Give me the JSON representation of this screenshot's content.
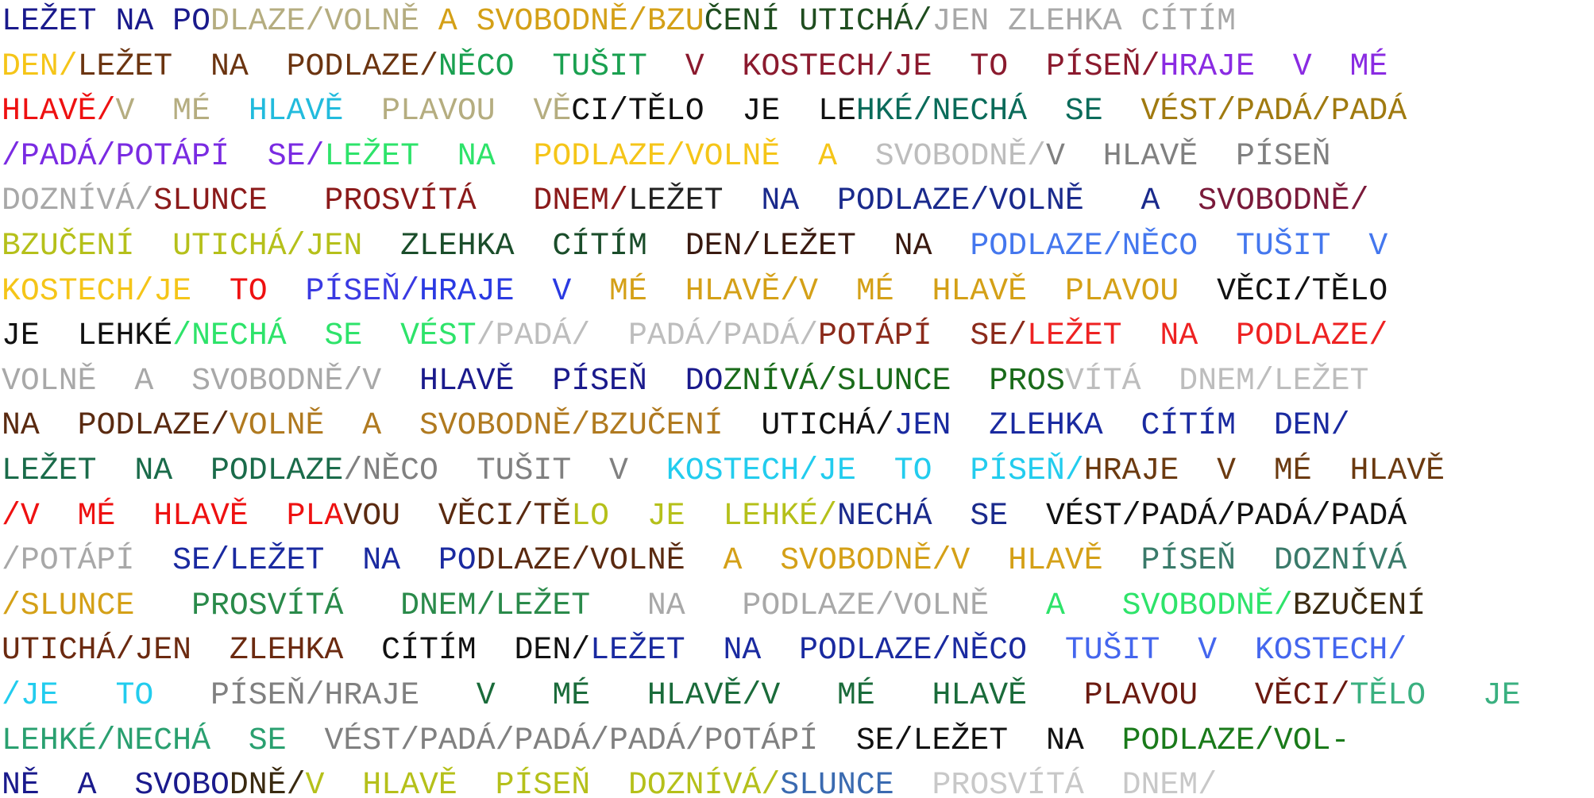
{
  "poem": {
    "lines": [
      [
        {
          "text": "LEŽET NA PO",
          "color": "#1a1a8c"
        },
        {
          "text": "DLAZE/VOLNĚ",
          "color": "#b5ad80"
        },
        {
          "text": " A SVOBODNĚ/BZU",
          "color": "#d4a017"
        },
        {
          "text": "ČENÍ UTICHÁ/",
          "color": "#1f4d1f"
        },
        {
          "text": "JEN ZLEHKA CÍTÍM",
          "color": "#a8a8a8"
        }
      ],
      [
        {
          "text": "DEN/",
          "color": "#f5c518"
        },
        {
          "text": "LEŽET  NA  PODLAZE/",
          "color": "#6b3410"
        },
        {
          "text": "NĚCO  TUŠIT",
          "color": "#1aa050"
        },
        {
          "text": "  V  KOSTECH/JE  TO  PÍSEŇ/",
          "color": "#8b1a2e"
        },
        {
          "text": "HRAJE  V  MÉ",
          "color": "#8a2be2"
        }
      ],
      [
        {
          "text": "HLAVĚ/",
          "color": "#ee1111"
        },
        {
          "text": "V  MÉ  ",
          "color": "#b5ad80"
        },
        {
          "text": "HLAVĚ",
          "color": "#22bbdd"
        },
        {
          "text": "  PLAVOU  VĚ",
          "color": "#b5ad80"
        },
        {
          "text": "CI/TĚLO  JE  LE",
          "color": "#111111"
        },
        {
          "text": "HKÉ/NECHÁ  SE",
          "color": "#0a6b5a"
        },
        {
          "text": "  VÉST/PADÁ/PADÁ",
          "color": "#a07a10"
        }
      ],
      [
        {
          "text": "/PADÁ/POTÁPÍ  SE/",
          "color": "#7a2be2"
        },
        {
          "text": "LEŽET  NA",
          "color": "#2ee36a"
        },
        {
          "text": "  PODLAZE/VOLNĚ  A",
          "color": "#f5c518"
        },
        {
          "text": "  SVOBODNĚ/",
          "color": "#bdbdbd"
        },
        {
          "text": "V  HLAVĚ  PÍSEŇ",
          "color": "#808080"
        }
      ],
      [
        {
          "text": "DOZNÍVÁ/",
          "color": "#a8a8a8"
        },
        {
          "text": "SLUNCE   PROSVÍTÁ   DNEM/",
          "color": "#8b1a1a"
        },
        {
          "text": "LEŽET  ",
          "color": "#222222"
        },
        {
          "text": "NA  PODLAZE/VOLNĚ   A",
          "color": "#1a2a8c"
        },
        {
          "text": "  SVOBODNĚ/",
          "color": "#7a1a3a"
        }
      ],
      [
        {
          "text": "BZUČENÍ  UTICHÁ/JEN",
          "color": "#b5c01a"
        },
        {
          "text": "  ZLEHKA  CÍTÍM",
          "color": "#1a4d2a"
        },
        {
          "text": "  DEN/LEŽET  NA",
          "color": "#3a1a10"
        },
        {
          "text": "  PODLAZE/NĚCO  TUŠIT  V",
          "color": "#4477ee"
        }
      ],
      [
        {
          "text": "KOSTECH/JE",
          "color": "#f5c518"
        },
        {
          "text": "  TO",
          "color": "#ee1111"
        },
        {
          "text": "  PÍSEŇ/",
          "color": "#3a3ae2"
        },
        {
          "text": "HRAJE  V",
          "color": "#2a3ae2"
        },
        {
          "text": "  MÉ  HLAVĚ/V  MÉ  HLAVĚ  PLAVOU",
          "color": "#d4a017"
        },
        {
          "text": "  VĚCI/TĚLO",
          "color": "#111111"
        }
      ],
      [
        {
          "text": "JE  LEHKÉ",
          "color": "#111111"
        },
        {
          "text": "/NECHÁ  SE  VÉST",
          "color": "#2ee36a"
        },
        {
          "text": "/PADÁ/  PADÁ/PADÁ/",
          "color": "#bdbdbd"
        },
        {
          "text": "POTÁPÍ  SE/",
          "color": "#8b2a1a"
        },
        {
          "text": "LEŽET  NA  PODLAZE/",
          "color": "#ee2222"
        }
      ],
      [
        {
          "text": "VOLNĚ  A  SVOBODNĚ/V",
          "color": "#a8a8a8"
        },
        {
          "text": "  HLAVĚ  PÍSEŇ  DO",
          "color": "#1a1a8c"
        },
        {
          "text": "ZNÍVÁ/SLUNCE  PROS",
          "color": "#1a6b1a"
        },
        {
          "text": "VÍTÁ  DNEM/LEŽET",
          "color": "#bdbdbd"
        }
      ],
      [
        {
          "text": "NA  PODLAZE/",
          "color": "#5a2a10"
        },
        {
          "text": "VOLNĚ  A  SVOBODNĚ/BZUČENÍ",
          "color": "#b07a20"
        },
        {
          "text": "  UTICHÁ/",
          "color": "#111111"
        },
        {
          "text": "JEN  ZLEHKA  CÍTÍM  DEN/",
          "color": "#1a2aa0"
        }
      ],
      [
        {
          "text": "LEŽET  NA  PODLAZE",
          "color": "#1a6b4a"
        },
        {
          "text": "/NĚCO  TUŠIT  V  ",
          "color": "#808080"
        },
        {
          "text": "KOSTECH/JE  TO  PÍSEŇ/",
          "color": "#22ccee"
        },
        {
          "text": "HRAJE  V  MÉ  HLAVĚ",
          "color": "#6b3a10"
        }
      ],
      [
        {
          "text": "/V  MÉ  HLAVĚ  PLA",
          "color": "#ee1111"
        },
        {
          "text": "VOU  VĚCI/TĚ",
          "color": "#5a2a10"
        },
        {
          "text": "LO  JE  LEHKÉ/",
          "color": "#b5c01a"
        },
        {
          "text": "NECHÁ  SE",
          "color": "#1a2a8c"
        },
        {
          "text": "  VÉST/PADÁ/PADÁ/PADÁ",
          "color": "#111111"
        }
      ],
      [
        {
          "text": "/POTÁPÍ",
          "color": "#a8a8a8"
        },
        {
          "text": "  SE/LEŽET  NA  PO",
          "color": "#1a2aa0"
        },
        {
          "text": "DLAZE/VOLNĚ",
          "color": "#5a2a10"
        },
        {
          "text": "  A  SVOBODNĚ/V  HLAVĚ",
          "color": "#d4a017"
        },
        {
          "text": "  PÍSEŇ  DOZNÍVÁ",
          "color": "#3a7a6a"
        }
      ],
      [
        {
          "text": "/SLUNCE",
          "color": "#d4a017"
        },
        {
          "text": "   PROSVÍTÁ   DNEM/LEŽET",
          "color": "#2a8a4a"
        },
        {
          "text": "   NA   PODLAZE/VOLNĚ",
          "color": "#a8a8a8"
        },
        {
          "text": "   A   SVOBODNĚ/",
          "color": "#2ee36a"
        },
        {
          "text": "BZUČENÍ",
          "color": "#3a2a10"
        }
      ],
      [
        {
          "text": "UTICHÁ/JEN  ZLEHKA",
          "color": "#6b2a10"
        },
        {
          "text": "  CÍTÍM  DEN/",
          "color": "#111111"
        },
        {
          "text": "LEŽET  NA  PODLAZE/NĚCO",
          "color": "#1a2aa0"
        },
        {
          "text": "  TUŠIT  V  KOSTECH/",
          "color": "#4466ee"
        }
      ],
      [
        {
          "text": "/JE   TO",
          "color": "#22ccee"
        },
        {
          "text": "   PÍSEŇ/HRAJE",
          "color": "#808080"
        },
        {
          "text": "   V   MÉ   HLAVĚ/V   MÉ   HLAVĚ",
          "color": "#1a6b3a"
        },
        {
          "text": "   PLAVOU   VĚCI/",
          "color": "#6b1a10"
        },
        {
          "text": "TĚLO   JE",
          "color": "#3ab080"
        }
      ],
      [
        {
          "text": "LEHKÉ/NECHÁ  SE",
          "color": "#2aa070"
        },
        {
          "text": "  VÉST/PADÁ/PADÁ/PADÁ/POTÁPÍ",
          "color": "#808080"
        },
        {
          "text": "  SE/LEŽET  NA",
          "color": "#111111"
        },
        {
          "text": "  PODLAZE/VOL-",
          "color": "#1a7a1a"
        }
      ],
      [
        {
          "text": "NĚ  A  SVOBO",
          "color": "#1a1a8c"
        },
        {
          "text": "DNĚ/",
          "color": "#3a2a10"
        },
        {
          "text": "V  HLAVĚ  PÍSEŇ  DOZNÍVÁ/",
          "color": "#b5c01a"
        },
        {
          "text": "SLUNCE",
          "color": "#3a6ab0"
        },
        {
          "text": "  PROSVÍTÁ  DNEM/",
          "color": "#c8c8c8"
        }
      ]
    ]
  }
}
